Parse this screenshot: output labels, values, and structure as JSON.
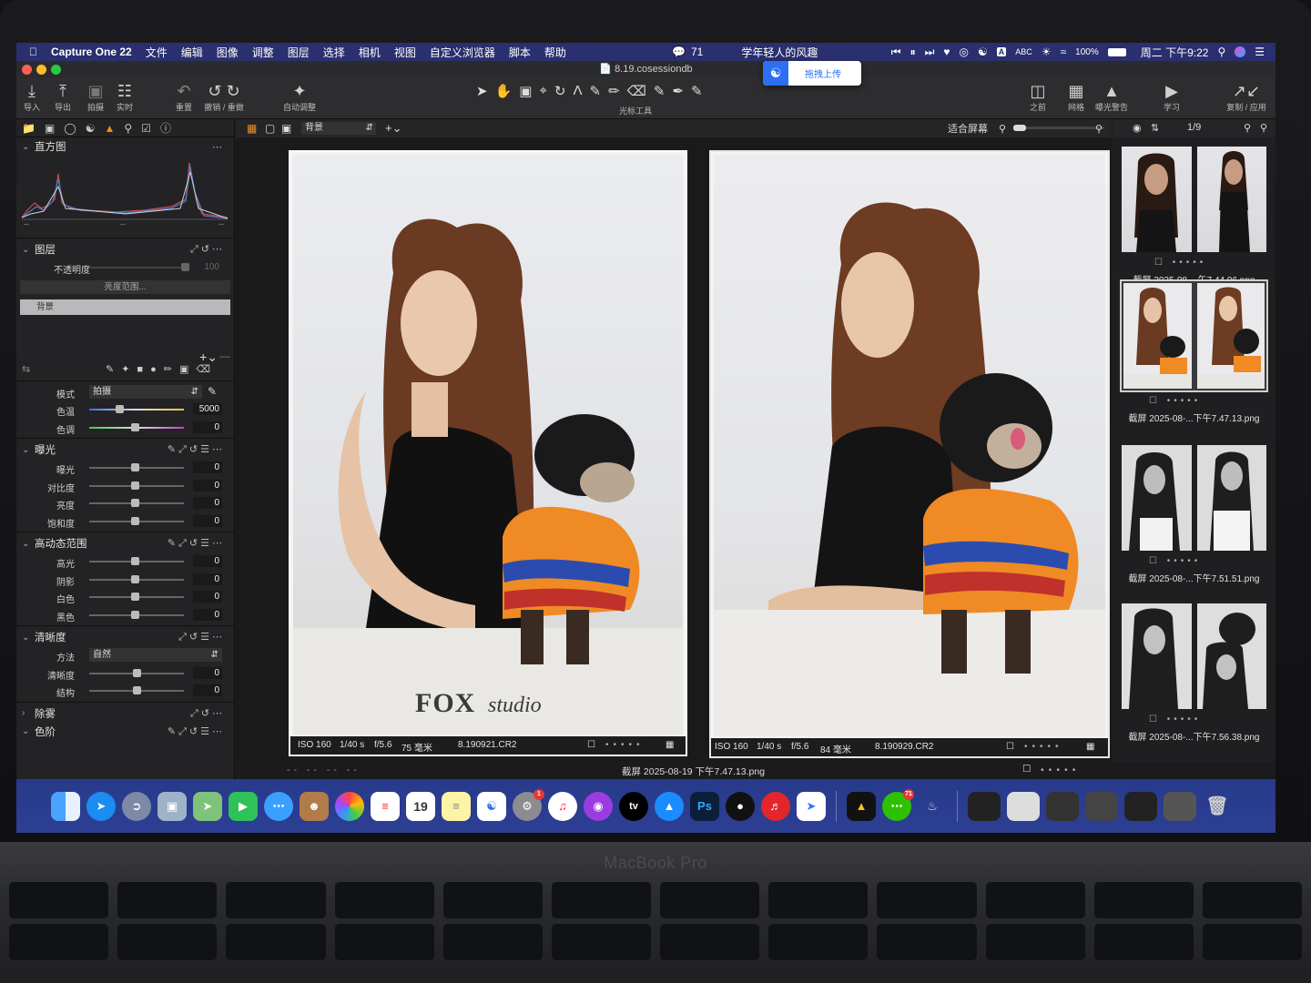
{
  "menubar": {
    "app_name": "Capture One 22",
    "menus": [
      "文件",
      "编辑",
      "图像",
      "调整",
      "图层",
      "选择",
      "相机",
      "视图",
      "自定义浏览器",
      "脚本",
      "帮助"
    ],
    "wechat_count": "71",
    "status_title": "学年轻人的风趣",
    "ime": "ABC",
    "battery": "100%",
    "clock": "周二 下午9:22"
  },
  "titlebar": {
    "document": "8.19.cosessiondb",
    "upload_label": "拖拽上传"
  },
  "toolbar": {
    "import": "导入",
    "export": "导出",
    "capture": "拍摄",
    "live": "实时",
    "reset": "重置",
    "undo_redo": "撤销 / 重做",
    "auto_adjust": "自动调整",
    "cursor_tools": "光标工具",
    "before": "之前",
    "grid": "网格",
    "exposure_warning": "曝光警告",
    "learn": "学习",
    "copy_apply": "复制 / 应用"
  },
  "left_panel": {
    "histogram": {
      "title": "直方图",
      "left_marker": "--",
      "mid_marker": "--",
      "right_marker": "--"
    },
    "layers": {
      "title": "图层",
      "opacity_label": "不透明度",
      "opacity_value": "100",
      "luma_range_button": "亮度范围...",
      "layer_name": "背景"
    },
    "white_balance": {
      "mode_label": "模式",
      "mode_value": "拍摄",
      "temp_label": "色温",
      "temp_value": "5000",
      "tint_label": "色调",
      "tint_value": "0"
    },
    "exposure": {
      "title": "曝光",
      "rows": [
        {
          "label": "曝光",
          "value": "0"
        },
        {
          "label": "对比度",
          "value": "0"
        },
        {
          "label": "亮度",
          "value": "0"
        },
        {
          "label": "饱和度",
          "value": "0"
        }
      ]
    },
    "hdr": {
      "title": "高动态范围",
      "rows": [
        {
          "label": "高光",
          "value": "0"
        },
        {
          "label": "阴影",
          "value": "0"
        },
        {
          "label": "白色",
          "value": "0"
        },
        {
          "label": "黑色",
          "value": "0"
        }
      ]
    },
    "clarity": {
      "title": "清晰度",
      "method_label": "方法",
      "method_value": "自然",
      "rows": [
        {
          "label": "清晰度",
          "value": "0"
        },
        {
          "label": "结构",
          "value": "0"
        }
      ]
    },
    "dehaze": {
      "title": "除雾"
    },
    "levels": {
      "title": "色阶"
    }
  },
  "viewer": {
    "layer_select": "背景",
    "fit_label": "适合屏幕",
    "count": "1/9",
    "photos": [
      {
        "iso": "ISO 160",
        "shutter": "1/40 s",
        "aperture": "f/5.6",
        "focal": "75 毫米",
        "file": "8.190921.CR2",
        "watermark_main": "FOX",
        "watermark_sub": "studio"
      },
      {
        "iso": "ISO 160",
        "shutter": "1/40 s",
        "aperture": "f/5.6",
        "focal": "84 毫米",
        "file": "8.190929.CR2"
      }
    ],
    "status_filename": "截屏 2025-08-19 下午7.47.13.png",
    "status_markers": "-- -- -- --"
  },
  "browser": {
    "thumbs": [
      {
        "name": "截屏 2025-08-...午7.44.06.png",
        "selected": false
      },
      {
        "name": "截屏 2025-08-...下午7.47.13.png",
        "selected": true
      },
      {
        "name": "截屏 2025-08-...下午7.51.51.png",
        "selected": false
      },
      {
        "name": "截屏 2025-08-...下午7.56.38.png",
        "selected": false
      }
    ]
  },
  "dock": {
    "apps": [
      "finder-icon",
      "safari-icon",
      "launchpad-icon",
      "preview-icon",
      "maps-icon",
      "facetime-icon",
      "messages-icon",
      "contacts-icon",
      "photos-icon",
      "reminders-icon",
      "calendar-icon",
      "notes-icon",
      "baidu-netdisk-icon",
      "system-settings-icon",
      "music-icon",
      "podcasts-icon",
      "tv-icon",
      "app-store-icon",
      "photoshop-icon",
      "capture-one-icon",
      "netease-music-icon",
      "lark-icon"
    ],
    "calendar_day": "19",
    "tv_label": "tv",
    "ps_label": "Ps",
    "wechat_badge": "71",
    "settings_badge": "1"
  },
  "laptop": {
    "model": "MacBook Pro"
  },
  "colors": {
    "accent": "#f08a24",
    "menubar": "#2a2f6f",
    "dock": "#2b3d90"
  }
}
